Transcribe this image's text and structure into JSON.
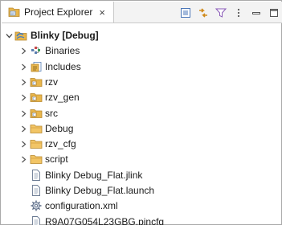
{
  "view": {
    "tab_title": "Project Explorer",
    "tab_close": "×"
  },
  "toolbar": {
    "buttons": [
      "collapse-all-icon",
      "link-with-editor-icon",
      "filter-icon",
      "view-menu-icon",
      "minimize-icon",
      "maximize-icon"
    ]
  },
  "tree": {
    "project": {
      "label": "Blinky [Debug]",
      "expanded": true
    },
    "items": [
      {
        "label": "Binaries",
        "icon": "binaries-icon",
        "expandable": true
      },
      {
        "label": "Includes",
        "icon": "includes-icon",
        "expandable": true
      },
      {
        "label": "rzv",
        "icon": "source-folder-icon",
        "expandable": true
      },
      {
        "label": "rzv_gen",
        "icon": "source-folder-icon",
        "expandable": true
      },
      {
        "label": "src",
        "icon": "source-folder-icon",
        "expandable": true
      },
      {
        "label": "Debug",
        "icon": "folder-icon",
        "expandable": true
      },
      {
        "label": "rzv_cfg",
        "icon": "folder-icon",
        "expandable": true
      },
      {
        "label": "script",
        "icon": "folder-icon",
        "expandable": true
      },
      {
        "label": "Blinky Debug_Flat.jlink",
        "icon": "file-icon",
        "expandable": false
      },
      {
        "label": "Blinky Debug_Flat.launch",
        "icon": "file-icon",
        "expandable": false
      },
      {
        "label": "configuration.xml",
        "icon": "gear-file-icon",
        "expandable": false
      },
      {
        "label": "R9A07G054L23GBG.pincfg",
        "icon": "file-icon",
        "expandable": false
      }
    ]
  },
  "colors": {
    "folder": "#e8b64c",
    "source_folder": "#e8b64c",
    "project_accent": "#3d7cc9",
    "selection": "#cce8ff"
  }
}
